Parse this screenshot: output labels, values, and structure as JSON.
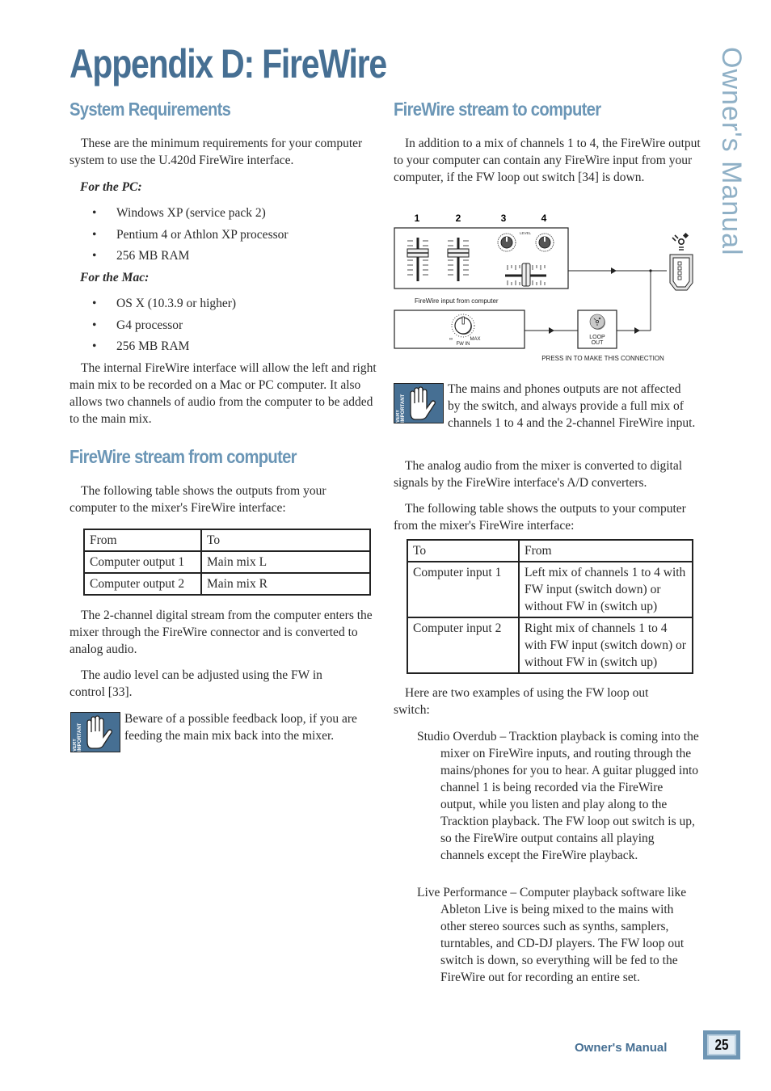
{
  "page": {
    "title": "Appendix D: FireWire",
    "side_label": "Owner's Manual",
    "footer_label": "Owner's Manual",
    "page_number": "25"
  },
  "left": {
    "system_requirements": {
      "heading": "System Requirements",
      "intro": "These are the minimum requirements for your computer system to use the U.420d FireWire interface.",
      "pc_label": "For the PC:",
      "pc_items": [
        "Windows XP (service pack 2)",
        "Pentium 4 or Athlon XP processor",
        "256 MB RAM"
      ],
      "mac_label": "For the Mac:",
      "mac_items": [
        "OS X (10.3.9 or higher)",
        "G4 processor",
        "256 MB RAM"
      ],
      "closing": "The internal FireWire interface will allow the left and right main mix to be recorded on a Mac or PC computer. It also allows two channels of audio from the computer to be added to the main mix."
    },
    "stream_from": {
      "heading": "FireWire stream from computer",
      "intro": "The following table shows the outputs from your computer to the mixer's FireWire interface:",
      "table": {
        "headers": [
          "From",
          "To"
        ],
        "rows": [
          [
            "Computer output 1",
            "Main mix L"
          ],
          [
            "Computer output 2",
            "Main mix R"
          ]
        ]
      },
      "para1": "The 2-channel digital stream from the computer enters the mixer through the FireWire connector and is converted to analog audio.",
      "para2": "The audio level can be adjusted using the FW in control [33].",
      "note_badge": "VERY IMPORTANT",
      "note": "Beware of a possible feedback loop, if you are feeding the main mix back into the mixer."
    }
  },
  "right": {
    "stream_to": {
      "heading": "FireWire stream to computer",
      "intro": "In addition to a mix of channels 1 to 4, the FireWire output to your computer can contain any FireWire input from your computer, if the FW loop out switch [34] is down.",
      "diagram": {
        "channel_labels": [
          "1",
          "2",
          "3",
          "4"
        ],
        "level_label": "LEVEL",
        "input_label": "FireWire input from computer",
        "fw_in_label": "FW IN",
        "knob_min": "∞",
        "knob_max": "MAX",
        "loop_label_1": "LOOP",
        "loop_label_2": "OUT",
        "caption": "PRESS IN TO MAKE THIS CONNECTION"
      },
      "note_badge": "VERY IMPORTANT",
      "note": "The mains and phones outputs are not affected by the switch, and always provide a full mix of channels 1 to 4 and the 2-channel FireWire input.",
      "para1": "The analog audio from the mixer is converted to digital signals by the FireWire interface's A/D converters.",
      "para2": "The following table shows the outputs to your computer from the mixer's FireWire interface:",
      "table": {
        "headers": [
          "To",
          "From"
        ],
        "rows": [
          [
            "Computer input 1",
            "Left mix of channels 1 to 4 with FW input (switch down) or without FW in (switch up)"
          ],
          [
            "Computer input 2",
            "Right mix of channels 1 to 4 with FW input (switch down) or without FW in (switch up)"
          ]
        ]
      },
      "examples_intro": "Here are two examples of using the FW loop out switch:",
      "examples": [
        "Studio Overdub – Tracktion playback is coming into the mixer on FireWire inputs, and routing through the mains/phones for you to hear. A guitar plugged into channel 1 is being recorded via the FireWire output, while you listen and play along to the Tracktion playback. The FW loop out switch is up, so the FireWire output contains all playing channels except the FireWire playback.",
        "Live Performance – Computer playback software like Ableton Live is being mixed to the mains with other stereo sources such as synths, samplers, turntables, and CD-DJ players. The FW loop out switch is down, so everything will be fed to the FireWire out for recording an entire set."
      ]
    }
  },
  "colors": {
    "title": "#466f93",
    "heading": "#6b96b6",
    "side_label": "#8fb0c6"
  }
}
